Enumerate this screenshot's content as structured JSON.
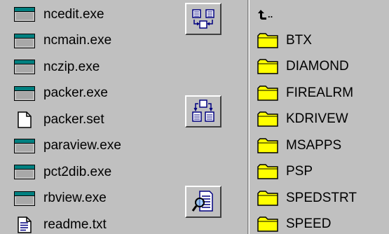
{
  "left_panel": {
    "files": [
      {
        "name": "ncedit.exe",
        "icon": "exe-icon"
      },
      {
        "name": "ncmain.exe",
        "icon": "exe-icon"
      },
      {
        "name": "nczip.exe",
        "icon": "exe-icon"
      },
      {
        "name": "packer.exe",
        "icon": "exe-icon"
      },
      {
        "name": "packer.set",
        "icon": "blank-document-icon"
      },
      {
        "name": "paraview.exe",
        "icon": "exe-icon"
      },
      {
        "name": "pct2dib.exe",
        "icon": "exe-icon"
      },
      {
        "name": "rbview.exe",
        "icon": "exe-icon"
      },
      {
        "name": "readme.txt",
        "icon": "text-document-icon"
      }
    ]
  },
  "toolbar": {
    "buttons": [
      {
        "icon": "compare-panels-icon"
      },
      {
        "icon": "sync-panels-icon"
      },
      {
        "icon": "view-file-icon"
      }
    ]
  },
  "right_panel": {
    "parent_dir_label": "..",
    "parent_dir_icon": "up-arrow-icon",
    "folders": [
      "BTX",
      "DIAMOND",
      "FIREALRM",
      "KDRIVEW",
      "MSAPPS",
      "PSP",
      "SPEDSTRT",
      "SPEED"
    ],
    "folder_icon": "folder-icon",
    "folder_color": "#ffff00"
  },
  "colors": {
    "background": "#c0c0c0",
    "exe_titlebar": "#008080",
    "toolbar_icon_blue": "#000080"
  }
}
